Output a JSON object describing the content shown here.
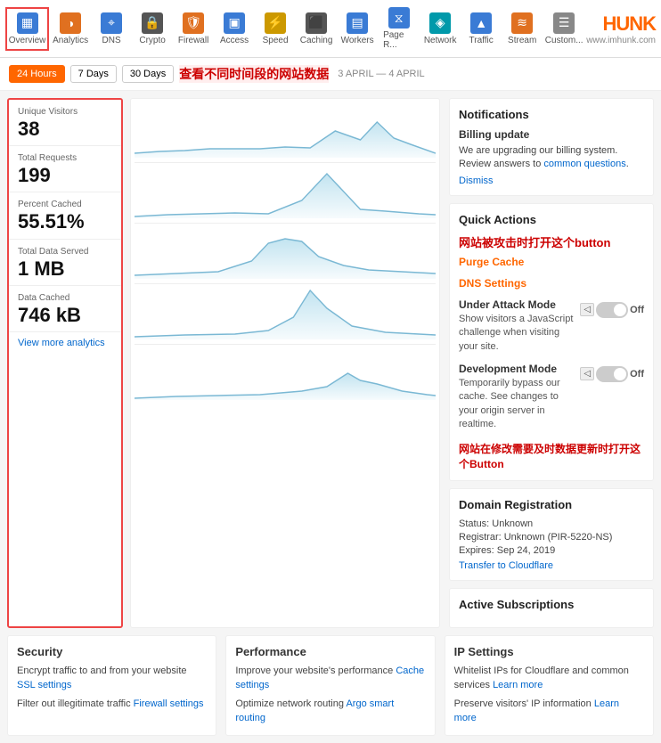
{
  "nav": {
    "items": [
      {
        "label": "Overview",
        "icon": "▦",
        "iconClass": "blue",
        "active": true
      },
      {
        "label": "Analytics",
        "icon": "◑",
        "iconClass": "orange"
      },
      {
        "label": "DNS",
        "icon": "⌖",
        "iconClass": "blue"
      },
      {
        "label": "Crypto",
        "icon": "🔒",
        "iconClass": "dark"
      },
      {
        "label": "Firewall",
        "icon": "🛡",
        "iconClass": "orange"
      },
      {
        "label": "Access",
        "icon": "▣",
        "iconClass": "blue"
      },
      {
        "label": "Speed",
        "icon": "⚡",
        "iconClass": "yellow"
      },
      {
        "label": "Caching",
        "icon": "⬛",
        "iconClass": "dark"
      },
      {
        "label": "Workers",
        "icon": "▤",
        "iconClass": "blue"
      },
      {
        "label": "Page R...",
        "icon": "⧖",
        "iconClass": "blue"
      },
      {
        "label": "Network",
        "icon": "◈",
        "iconClass": "teal"
      },
      {
        "label": "Traffic",
        "icon": "▲",
        "iconClass": "blue"
      },
      {
        "label": "Stream",
        "icon": "≋",
        "iconClass": "orange"
      },
      {
        "label": "Custom...",
        "icon": "☰",
        "iconClass": "gray"
      }
    ],
    "logo": "HUNK",
    "logo_url": "www.imhunk.com"
  },
  "time_bar": {
    "buttons": [
      "24 Hours",
      "7 Days",
      "30 Days"
    ],
    "active_button": "24 Hours",
    "date_range": "3 APRIL — 4 APRIL",
    "annotation": "查看不同时间段的网站数据"
  },
  "stats": {
    "items": [
      {
        "label": "Unique Visitors",
        "value": "38"
      },
      {
        "label": "Total Requests",
        "value": "199"
      },
      {
        "label": "Percent Cached",
        "value": "55.51%"
      },
      {
        "label": "Total Data Served",
        "value": "1 MB"
      },
      {
        "label": "Data Cached",
        "value": "746 kB"
      }
    ],
    "view_more": "View more analytics"
  },
  "notifications": {
    "title": "Notifications",
    "billing": {
      "subtitle": "Billing update",
      "text": "We are upgrading our billing system. Review answers to",
      "link_text": "common questions",
      "dismiss": "Dismiss"
    }
  },
  "quick_actions": {
    "title": "Quick Actions",
    "annotation": "网站被攻击时打开这个button",
    "purge_cache": "Purge Cache",
    "dns_settings": "DNS Settings",
    "under_attack": {
      "title": "Under Attack Mode",
      "desc": "Show visitors a JavaScript challenge when visiting your site.",
      "toggle_state": "Off"
    },
    "dev_mode": {
      "title": "Development Mode",
      "desc": "Temporarily bypass our cache. See changes to your origin server in realtime.",
      "toggle_state": "Off"
    },
    "annotation2": "网站在修改需要及时数据更新时打开这个Button"
  },
  "domain": {
    "title": "Domain Registration",
    "status": "Status: Unknown",
    "registrar": "Registrar: Unknown (PIR-5220-NS)",
    "expires": "Expires: Sep 24, 2019",
    "transfer_link": "Transfer to Cloudflare"
  },
  "active_subs": {
    "title": "Active Subscriptions"
  },
  "bottom": {
    "security": {
      "title": "Security",
      "text1": "Encrypt traffic to and from your website",
      "link1": "SSL settings",
      "text2": "Filter out illegitimate traffic",
      "link2": "Firewall settings"
    },
    "performance": {
      "title": "Performance",
      "text1": "Improve your website's performance",
      "link1": "Cache settings",
      "text2": "Optimize network routing",
      "link2": "Argo smart routing"
    },
    "ip_settings": {
      "title": "IP Settings",
      "text1": "Whitelist IPs for Cloudflare and common services",
      "link1": "Learn more",
      "text2": "Preserve visitors' IP information",
      "link2": "Learn more"
    }
  }
}
